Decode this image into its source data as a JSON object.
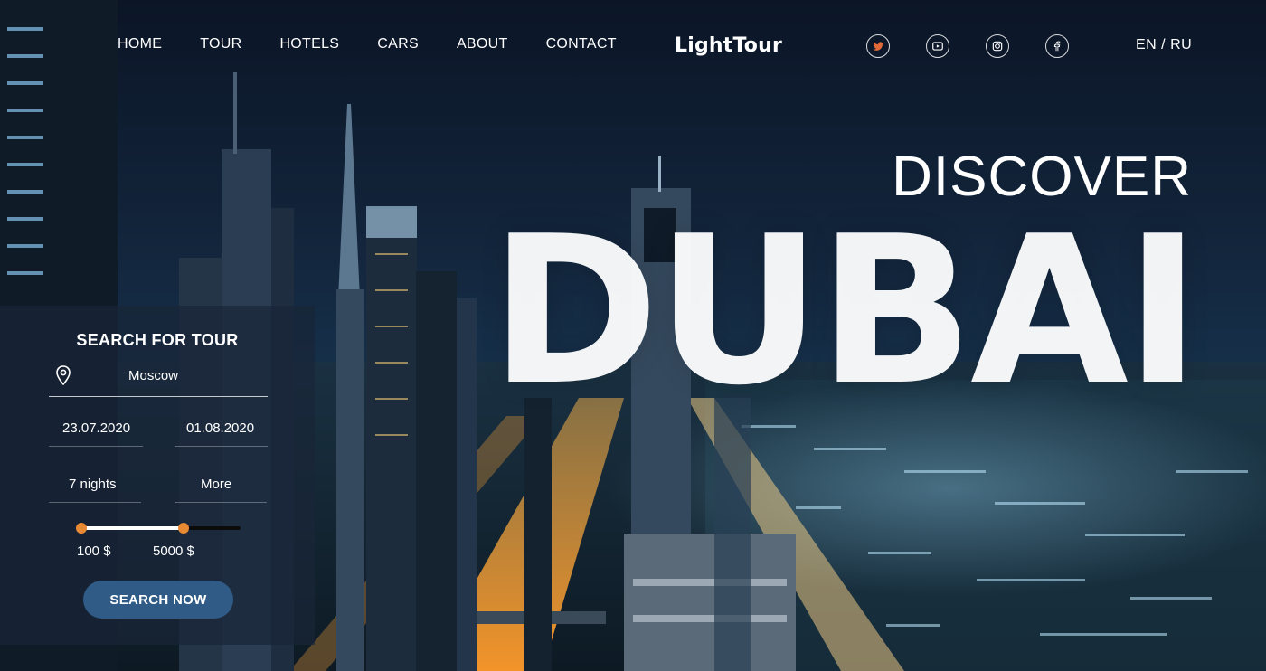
{
  "nav": {
    "items": [
      "HOME",
      "TOUR",
      "HOTELS",
      "CARS",
      "ABOUT",
      "CONTACT"
    ]
  },
  "logo": "LightTour",
  "socials": [
    "twitter-icon",
    "youtube-icon",
    "instagram-icon",
    "facebook-icon"
  ],
  "lang": "EN / RU",
  "hero": {
    "discover": "DISCOVER",
    "city": "DUBAI"
  },
  "search": {
    "title": "SEARCH FOR TOUR",
    "location": "Moscow",
    "date_from": "23.07.2020",
    "date_to": "01.08.2020",
    "nights": "7 nights",
    "more": "More",
    "price_min": "100 $",
    "price_max": "5000 $",
    "range_selected_fraction": 0.64,
    "button": "SEARCH NOW"
  },
  "colors": {
    "accent": "#e88a33",
    "button": "#2f5b86",
    "panel": "#192637"
  }
}
